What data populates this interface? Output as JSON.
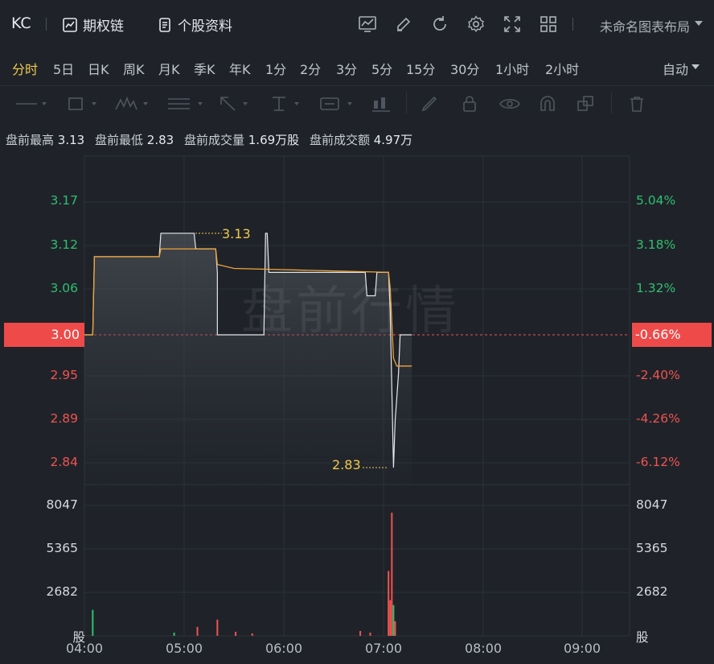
{
  "header": {
    "ticker": "KC",
    "options_chain": "期权链",
    "stock_info": "个股资料",
    "layout_name": "未命名图表布局"
  },
  "periods": [
    "分时",
    "5日",
    "日K",
    "周K",
    "月K",
    "季K",
    "年K",
    "1分",
    "2分",
    "3分",
    "5分",
    "15分",
    "30分",
    "1小时",
    "2小时"
  ],
  "active_period": "分时",
  "auto_label": "自动",
  "info": {
    "high_label": "盘前最高",
    "high": "3.13",
    "low_label": "盘前最低",
    "low": "2.83",
    "vol_label": "盘前成交量",
    "vol": "1.69万股",
    "amt_label": "盘前成交额",
    "amt": "4.97万"
  },
  "watermark": "盘前行情",
  "chart_data": {
    "type": "line",
    "prev_close": 3.0,
    "last_price": "3.00",
    "last_pct": "-0.66%",
    "y_price_ticks": [
      "3.17",
      "3.12",
      "3.06",
      "2.95",
      "2.89",
      "2.84"
    ],
    "y_pct_ticks": [
      "5.04%",
      "3.18%",
      "1.32%",
      "-2.40%",
      "-4.26%",
      "-6.12%"
    ],
    "volume_ticks": [
      "8047",
      "5365",
      "2682"
    ],
    "volume_unit": "股",
    "x_ticks": [
      "04:00",
      "05:00",
      "06:00",
      "07:00",
      "08:00",
      "09:00"
    ],
    "high_marker": "3.13",
    "low_marker": "2.83",
    "price_series": [
      [
        0,
        3.0
      ],
      [
        5,
        3.0
      ],
      [
        6,
        3.1
      ],
      [
        45,
        3.1
      ],
      [
        46,
        3.13
      ],
      [
        66,
        3.13
      ],
      [
        67,
        3.11
      ],
      [
        79,
        3.11
      ],
      [
        80,
        3.08
      ],
      [
        80,
        3.0
      ],
      [
        107,
        3.0
      ],
      [
        108,
        3.0
      ],
      [
        109,
        3.13
      ],
      [
        110,
        3.13
      ],
      [
        111,
        3.08
      ],
      [
        169,
        3.08
      ],
      [
        170,
        3.05
      ],
      [
        175,
        3.05
      ],
      [
        176,
        3.08
      ],
      [
        183,
        3.08
      ],
      [
        184,
        3.03
      ],
      [
        186,
        2.83
      ],
      [
        187,
        2.89
      ],
      [
        189,
        2.95
      ],
      [
        190,
        3.0
      ],
      [
        197,
        3.0
      ]
    ],
    "avg_series": [
      [
        0,
        3.0
      ],
      [
        5,
        3.0
      ],
      [
        6,
        3.1
      ],
      [
        45,
        3.1
      ],
      [
        46,
        3.11
      ],
      [
        79,
        3.11
      ],
      [
        80,
        3.09
      ],
      [
        90,
        3.085
      ],
      [
        183,
        3.08
      ],
      [
        184,
        3.06
      ],
      [
        186,
        2.97
      ],
      [
        188,
        2.96
      ],
      [
        190,
        2.96
      ],
      [
        197,
        2.96
      ]
    ],
    "volume_bars": [
      [
        5,
        1600,
        "green"
      ],
      [
        54,
        200,
        "green"
      ],
      [
        68,
        550,
        "red"
      ],
      [
        80,
        1000,
        "red"
      ],
      [
        91,
        250,
        "red"
      ],
      [
        101,
        150,
        "red"
      ],
      [
        166,
        300,
        "red"
      ],
      [
        172,
        200,
        "red"
      ],
      [
        183,
        4000,
        "red"
      ],
      [
        184,
        2200,
        "red"
      ],
      [
        185,
        7600,
        "red"
      ],
      [
        186,
        1900,
        "green"
      ],
      [
        187,
        900,
        "red"
      ]
    ]
  }
}
